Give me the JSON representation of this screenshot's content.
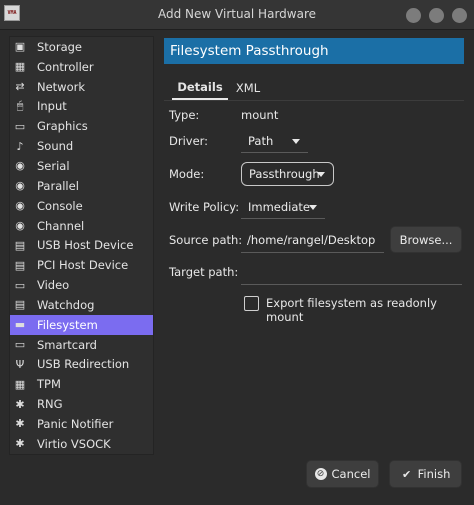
{
  "window": {
    "title": "Add New Virtual Hardware",
    "app_icon_text": "VMA"
  },
  "sidebar": {
    "selected_index": 14,
    "items": [
      {
        "label": "Storage",
        "icon": "storage-icon",
        "glyph": "▣"
      },
      {
        "label": "Controller",
        "icon": "controller-icon",
        "glyph": "▦"
      },
      {
        "label": "Network",
        "icon": "network-icon",
        "glyph": "⇄"
      },
      {
        "label": "Input",
        "icon": "mouse-icon",
        "glyph": "🖱"
      },
      {
        "label": "Graphics",
        "icon": "monitor-icon",
        "glyph": "▭"
      },
      {
        "label": "Sound",
        "icon": "speaker-icon",
        "glyph": "♪"
      },
      {
        "label": "Serial",
        "icon": "serial-port-icon",
        "glyph": "◉"
      },
      {
        "label": "Parallel",
        "icon": "parallel-port-icon",
        "glyph": "◉"
      },
      {
        "label": "Console",
        "icon": "console-icon",
        "glyph": "◉"
      },
      {
        "label": "Channel",
        "icon": "channel-icon",
        "glyph": "◉"
      },
      {
        "label": "USB Host Device",
        "icon": "usb-device-icon",
        "glyph": "▤"
      },
      {
        "label": "PCI Host Device",
        "icon": "pci-device-icon",
        "glyph": "▤"
      },
      {
        "label": "Video",
        "icon": "video-icon",
        "glyph": "▭"
      },
      {
        "label": "Watchdog",
        "icon": "watchdog-icon",
        "glyph": "▤"
      },
      {
        "label": "Filesystem",
        "icon": "folder-icon",
        "glyph": "▬"
      },
      {
        "label": "Smartcard",
        "icon": "smartcard-icon",
        "glyph": "▭"
      },
      {
        "label": "USB Redirection",
        "icon": "usb-icon",
        "glyph": "Ψ"
      },
      {
        "label": "TPM",
        "icon": "tpm-chip-icon",
        "glyph": "▦"
      },
      {
        "label": "RNG",
        "icon": "rng-icon",
        "glyph": "✱"
      },
      {
        "label": "Panic Notifier",
        "icon": "panic-notifier-icon",
        "glyph": "✱"
      },
      {
        "label": "Virtio VSOCK",
        "icon": "vsock-icon",
        "glyph": "✱"
      }
    ]
  },
  "panel": {
    "header": "Filesystem Passthrough",
    "tabs": [
      "Details",
      "XML"
    ],
    "active_tab": "Details",
    "fields": {
      "type_label": "Type:",
      "type_value": "mount",
      "driver_label": "Driver:",
      "driver_value": "Path",
      "mode_label": "Mode:",
      "mode_value": "Passthrough",
      "write_policy_label": "Write Policy:",
      "write_policy_value": "Immediate",
      "source_path_label": "Source path:",
      "source_path_value": "/home/rangel/Desktop",
      "browse_label": "Browse...",
      "target_path_label": "Target path:",
      "target_path_value": "",
      "readonly_label": "Export filesystem as readonly mount",
      "readonly_checked": false
    }
  },
  "footer": {
    "cancel_label": "Cancel",
    "finish_label": "Finish"
  },
  "colors": {
    "header_blue": "#1b6fa6",
    "selection_purple": "#7b6cf0",
    "background": "#2b2b2b"
  }
}
